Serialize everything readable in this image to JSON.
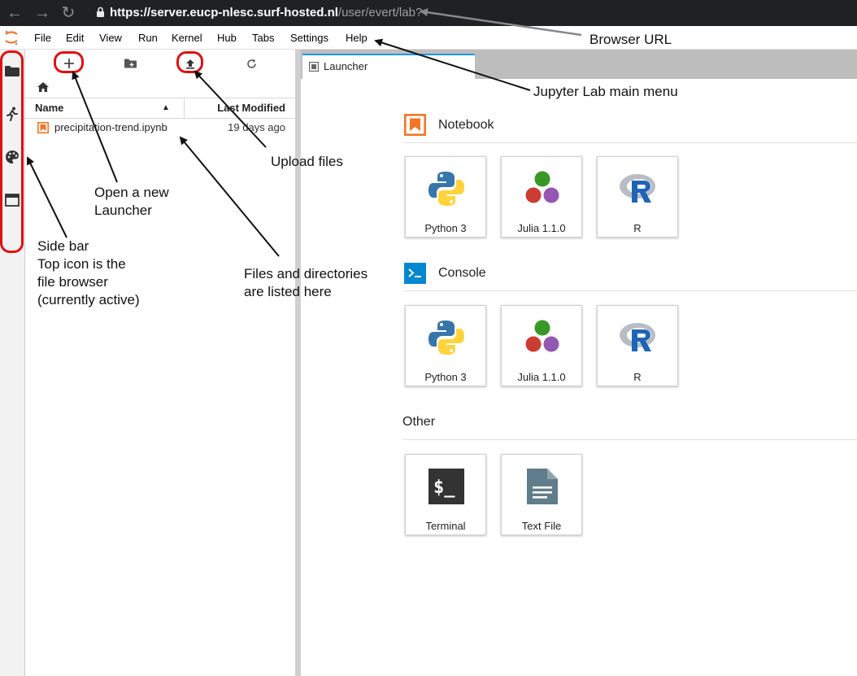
{
  "browser": {
    "url_host": "https://server.eucp-nlesc.surf-hosted.nl",
    "url_path": "/user/evert/lab?"
  },
  "menu": [
    "File",
    "Edit",
    "View",
    "Run",
    "Kernel",
    "Hub",
    "Tabs",
    "Settings",
    "Help"
  ],
  "file_browser": {
    "columns": {
      "name": "Name",
      "modified": "Last Modified"
    },
    "files": [
      {
        "name": "precipitation-trend.ipynb",
        "modified": "19 days ago"
      }
    ]
  },
  "tabs": [
    {
      "label": "Launcher",
      "icon": "launcher-icon"
    }
  ],
  "launcher": {
    "sections": [
      {
        "title": "Notebook",
        "icon": "notebook-icon",
        "cards": [
          {
            "label": "Python 3",
            "icon": "python-icon"
          },
          {
            "label": "Julia 1.1.0",
            "icon": "julia-icon"
          },
          {
            "label": "R",
            "icon": "r-icon"
          }
        ]
      },
      {
        "title": "Console",
        "icon": "console-icon",
        "cards": [
          {
            "label": "Python 3",
            "icon": "python-icon"
          },
          {
            "label": "Julia 1.1.0",
            "icon": "julia-icon"
          },
          {
            "label": "R",
            "icon": "r-icon"
          }
        ]
      },
      {
        "title": "Other",
        "cards": [
          {
            "label": "Terminal",
            "icon": "terminal-icon"
          },
          {
            "label": "Text File",
            "icon": "text-file-icon"
          }
        ]
      }
    ]
  },
  "annotations": {
    "browser_url": "Browser URL",
    "main_menu": "Jupyter Lab main menu",
    "upload_files": "Upload files",
    "new_launcher_1": "Open a new",
    "new_launcher_2": "Launcher",
    "sidebar_1": "Side bar",
    "sidebar_2": "Top icon is the",
    "sidebar_3": "file browser",
    "sidebar_4": "(currently active)",
    "files_1": "Files and directories",
    "files_2": "are listed here"
  },
  "colors": {
    "accent_tab": "#2196f3",
    "annotation_red": "#e01010",
    "notebook_orange": "#f37626",
    "console_blue": "#0288d1"
  }
}
